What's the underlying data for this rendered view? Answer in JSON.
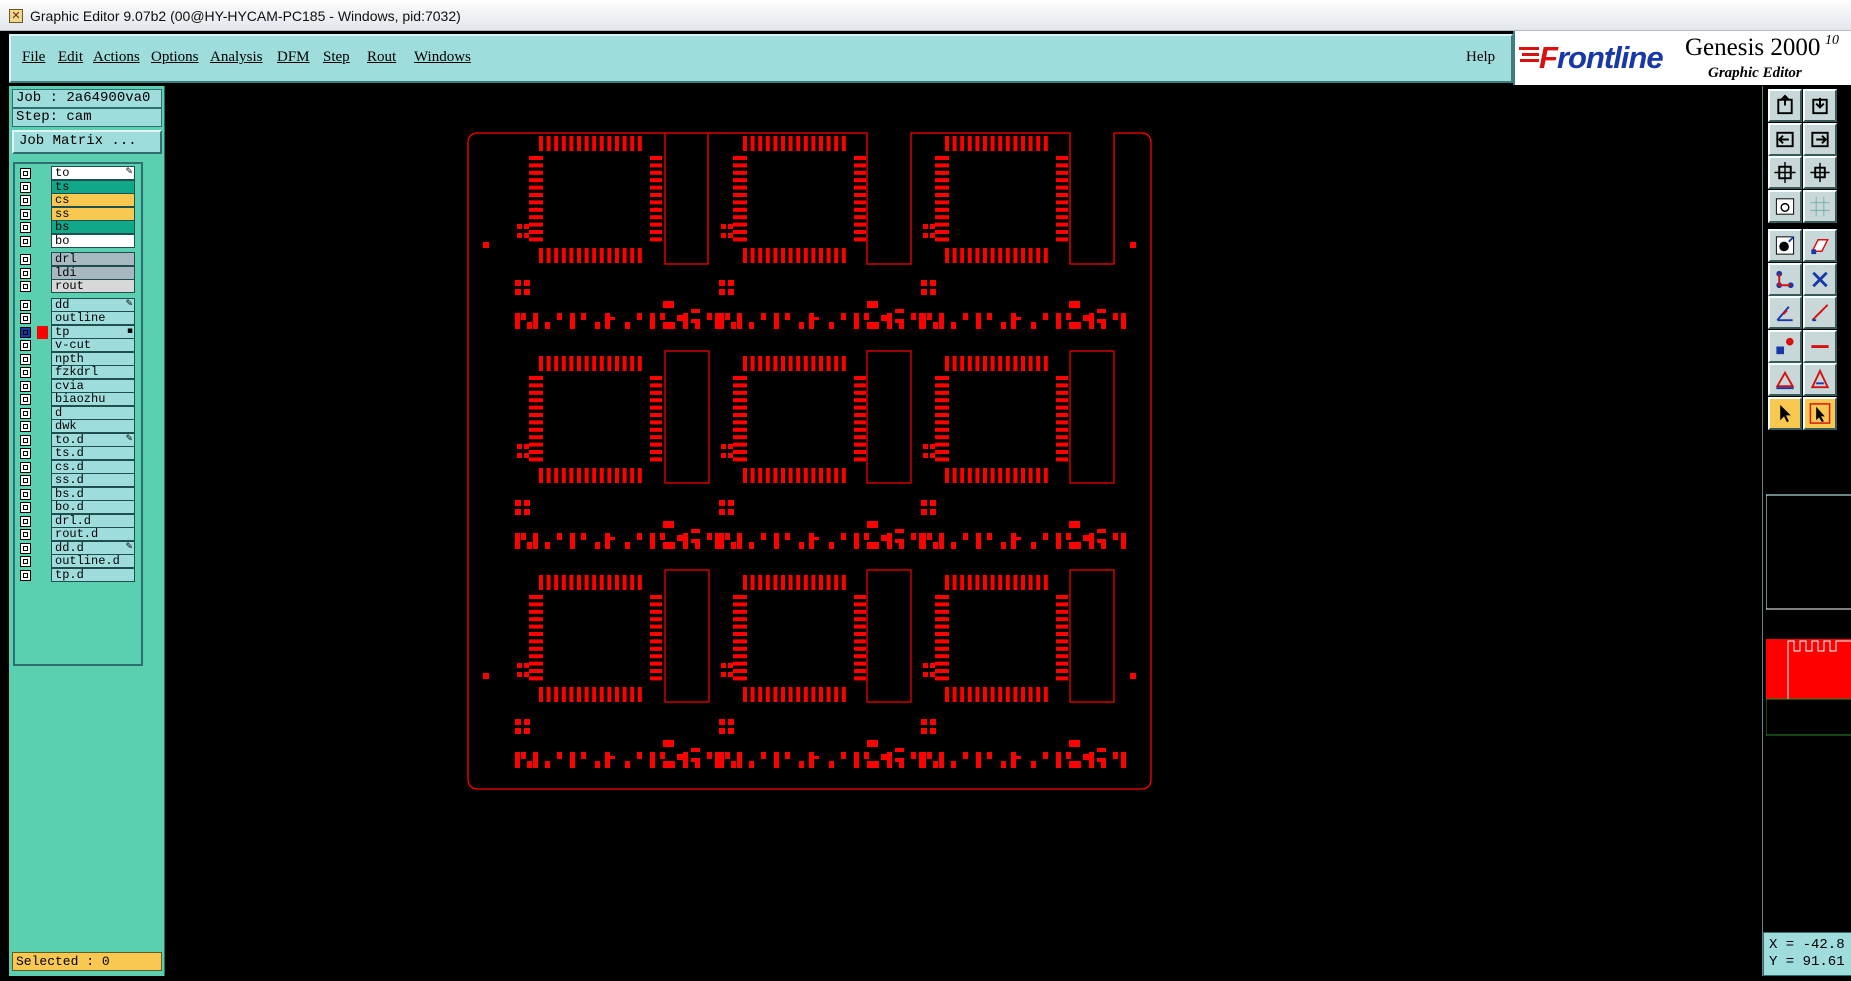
{
  "window": {
    "title": "Graphic Editor 9.07b2 (00@HY-HYCAM-PC185 - Windows, pid:7032)"
  },
  "menu": {
    "items": [
      {
        "label": "File"
      },
      {
        "label": "Edit"
      },
      {
        "label": "Actions"
      },
      {
        "label": "Options"
      },
      {
        "label": "Analysis"
      },
      {
        "label": "DFM"
      },
      {
        "label": "Step"
      },
      {
        "label": "Rout"
      },
      {
        "label": "Windows"
      }
    ],
    "help": "Help"
  },
  "logo": {
    "brand_red": "F",
    "brand_rest": "rontline",
    "product": "Genesis 2000",
    "superscript": "10",
    "subtitle": "Graphic Editor"
  },
  "left_panel": {
    "job": "Job : 2a64900va0",
    "step": "Step: cam",
    "job_matrix_button": "Job Matrix ...",
    "layers": [
      {
        "name": "to",
        "color": "#ffffff",
        "mark": "pencil"
      },
      {
        "name": "ts",
        "color": "#10a888"
      },
      {
        "name": "cs",
        "color": "#f8c850"
      },
      {
        "name": "ss",
        "color": "#f8c850"
      },
      {
        "name": "bs",
        "color": "#10a888"
      },
      {
        "name": "bo",
        "color": "#ffffff"
      },
      {
        "name": "drl",
        "color": "#a8b8c0"
      },
      {
        "name": "ldi",
        "color": "#a8b8c0"
      },
      {
        "name": "rout",
        "color": "#d8d8d8"
      },
      {
        "name": "dd",
        "color": "#9fdcdc",
        "mark": "pencil"
      },
      {
        "name": "outline",
        "color": "#9fdcdc"
      },
      {
        "name": "tp",
        "color": "#9fdcdc",
        "work": true,
        "mark": "dot"
      },
      {
        "name": "v-cut",
        "color": "#9fdcdc"
      },
      {
        "name": "npth",
        "color": "#9fdcdc"
      },
      {
        "name": "fzkdrl",
        "color": "#9fdcdc"
      },
      {
        "name": "cvia",
        "color": "#9fdcdc"
      },
      {
        "name": "biaozhu",
        "color": "#9fdcdc"
      },
      {
        "name": "d",
        "color": "#9fdcdc"
      },
      {
        "name": "dwk",
        "color": "#9fdcdc"
      },
      {
        "name": "to.d",
        "color": "#9fdcdc",
        "mark": "pencil"
      },
      {
        "name": "ts.d",
        "color": "#9fdcdc"
      },
      {
        "name": "cs.d",
        "color": "#9fdcdc"
      },
      {
        "name": "ss.d",
        "color": "#9fdcdc"
      },
      {
        "name": "bs.d",
        "color": "#9fdcdc"
      },
      {
        "name": "bo.d",
        "color": "#9fdcdc"
      },
      {
        "name": "drl.d",
        "color": "#9fdcdc"
      },
      {
        "name": "rout.d",
        "color": "#9fdcdc"
      },
      {
        "name": "dd.d",
        "color": "#9fdcdc",
        "mark": "pencil"
      },
      {
        "name": "outline.d",
        "color": "#9fdcdc"
      },
      {
        "name": "tp.d",
        "color": "#9fdcdc"
      }
    ],
    "selected": "Selected : 0"
  },
  "right_panel": {
    "tools": [
      "open-icon",
      "save-icon",
      "previous-icon",
      "next-icon",
      "zoom-fit-icon",
      "zoom-home-icon",
      "snapshot-icon",
      "grid-icon",
      "add-pad-icon",
      "edit-shape-icon",
      "connect-icon",
      "delete-icon",
      "measure-icon",
      "draw-line-icon",
      "pad-icon",
      "line-icon",
      "triangle-icon",
      "triangle-filled-icon",
      "select-icon",
      "select-box-icon"
    ],
    "coord_x": "X = -42.8",
    "coord_y": "Y = 91.61"
  },
  "colors": {
    "feature": "#ff0000",
    "panel": "#5bd0b0",
    "menu": "#9fdcdc",
    "highlight": "#f8c850"
  }
}
